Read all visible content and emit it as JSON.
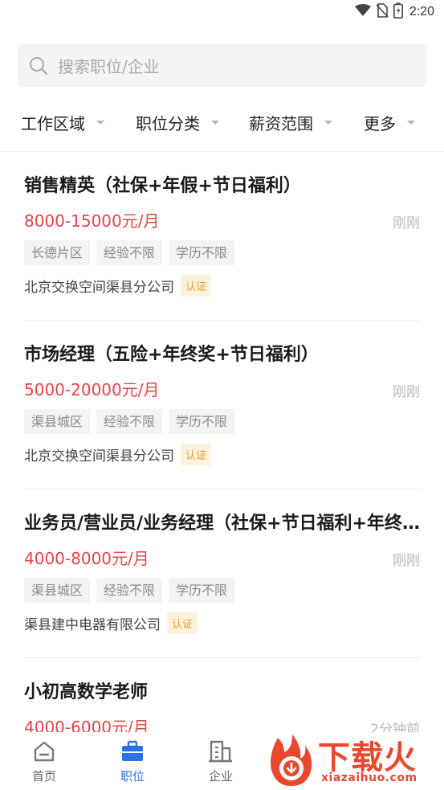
{
  "status_bar": {
    "time": "2:20",
    "icons": [
      "wifi-icon",
      "no-sim-icon",
      "battery-icon"
    ]
  },
  "search": {
    "placeholder": "搜索职位/企业"
  },
  "filters": [
    {
      "label": "工作区域"
    },
    {
      "label": "职位分类"
    },
    {
      "label": "薪资范围"
    },
    {
      "label": "更多"
    }
  ],
  "jobs": [
    {
      "title": "销售精英（社保+年假+节日福利）",
      "salary": "8000-15000元/月",
      "time": "刚刚",
      "tags": [
        "长德片区",
        "经验不限",
        "学历不限"
      ],
      "company": "北京交换空间渠县分公司",
      "badge": "认证"
    },
    {
      "title": "市场经理（五险+年终奖+节日福利）",
      "salary": "5000-20000元/月",
      "time": "刚刚",
      "tags": [
        "渠县城区",
        "经验不限",
        "学历不限"
      ],
      "company": "北京交换空间渠县分公司",
      "badge": "认证"
    },
    {
      "title": "业务员/营业员/业务经理（社保+节日福利+年终奖）",
      "salary": "4000-8000元/月",
      "time": "刚刚",
      "tags": [
        "渠县城区",
        "经验不限",
        "学历不限"
      ],
      "company": "渠县建中电器有限公司",
      "badge": "认证"
    },
    {
      "title": "小初高数学老师",
      "salary": "4000-6000元/月",
      "time": "2分钟前"
    }
  ],
  "tabs": [
    {
      "label": "首页",
      "icon": "home-icon",
      "active": false
    },
    {
      "label": "职位",
      "icon": "briefcase-icon",
      "active": true
    },
    {
      "label": "企业",
      "icon": "building-icon",
      "active": false
    }
  ],
  "watermark": {
    "text": "下载火",
    "sub": "xiazaihuo.com"
  },
  "colors": {
    "accent": "#2a73e6",
    "salary": "#e8424a",
    "badge_text": "#e79b2e",
    "badge_bg": "#fdf2dd",
    "watermark": "#e8492e"
  }
}
